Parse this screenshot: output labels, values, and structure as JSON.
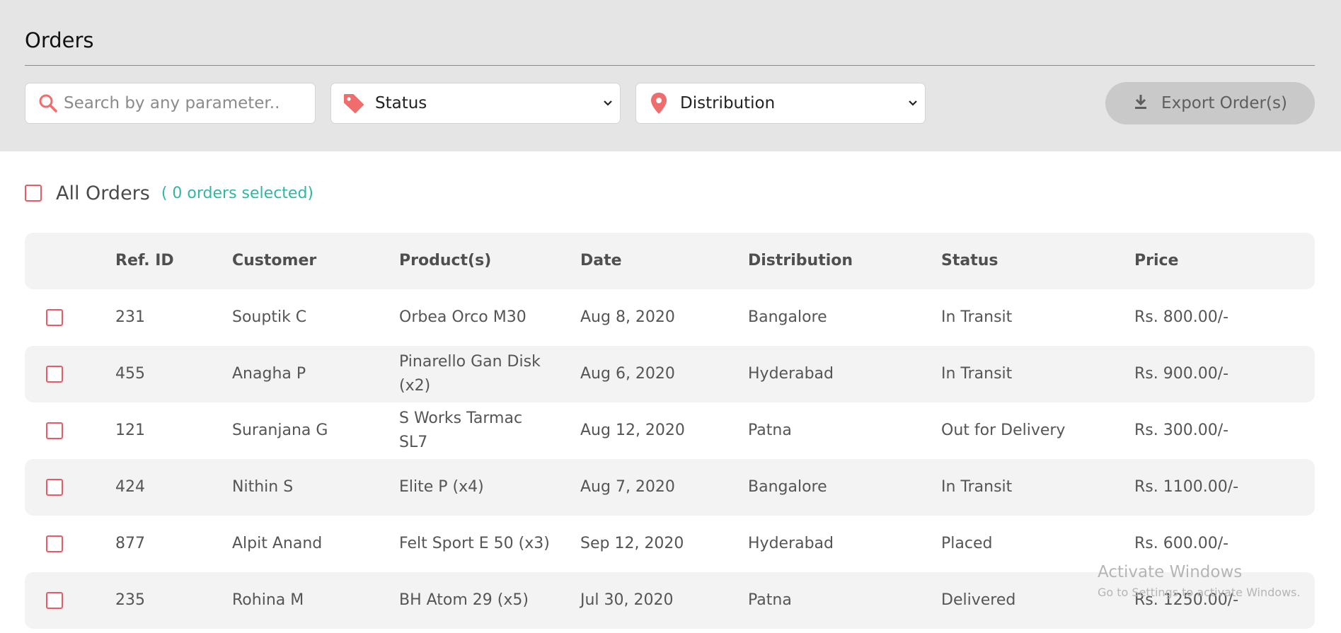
{
  "header": {
    "title": "Orders"
  },
  "filters": {
    "search_placeholder": "Search by any parameter..",
    "status_label": "Status",
    "distribution_label": "Distribution",
    "export_label": "Export Order(s)"
  },
  "selection": {
    "all_label": "All Orders",
    "count_label": "( 0 orders selected)"
  },
  "table": {
    "columns": [
      "Ref. ID",
      "Customer",
      "Product(s)",
      "Date",
      "Distribution",
      "Status",
      "Price"
    ],
    "rows": [
      {
        "ref": "231",
        "customer": "Souptik C",
        "product": "Orbea Orco M30",
        "date": "Aug 8, 2020",
        "distribution": "Bangalore",
        "status": "In Transit",
        "price": "Rs. 800.00/-"
      },
      {
        "ref": "455",
        "customer": "Anagha P",
        "product": "Pinarello Gan Disk (x2)",
        "date": "Aug 6, 2020",
        "distribution": "Hyderabad",
        "status": "In Transit",
        "price": "Rs. 900.00/-"
      },
      {
        "ref": "121",
        "customer": "Suranjana G",
        "product": "S Works Tarmac SL7",
        "date": "Aug 12, 2020",
        "distribution": "Patna",
        "status": "Out for Delivery",
        "price": "Rs. 300.00/-"
      },
      {
        "ref": "424",
        "customer": "Nithin S",
        "product": "Elite P (x4)",
        "date": "Aug 7, 2020",
        "distribution": "Bangalore",
        "status": "In Transit",
        "price": "Rs. 1100.00/-"
      },
      {
        "ref": "877",
        "customer": "Alpit Anand",
        "product": "Felt Sport E 50 (x3)",
        "date": "Sep 12, 2020",
        "distribution": "Hyderabad",
        "status": "Placed",
        "price": "Rs. 600.00/-"
      },
      {
        "ref": "235",
        "customer": "Rohina M",
        "product": "BH Atom 29 (x5)",
        "date": "Jul 30, 2020",
        "distribution": "Patna",
        "status": "Delivered",
        "price": "Rs. 1250.00/-"
      }
    ]
  },
  "watermark": {
    "line1": "Activate Windows",
    "line2": "Go to Settings to activate Windows."
  },
  "colors": {
    "accent": "#e85b63",
    "teal": "#2fb7a0",
    "header_bg": "#e5e5e5",
    "row_shade": "#f3f3f3"
  }
}
